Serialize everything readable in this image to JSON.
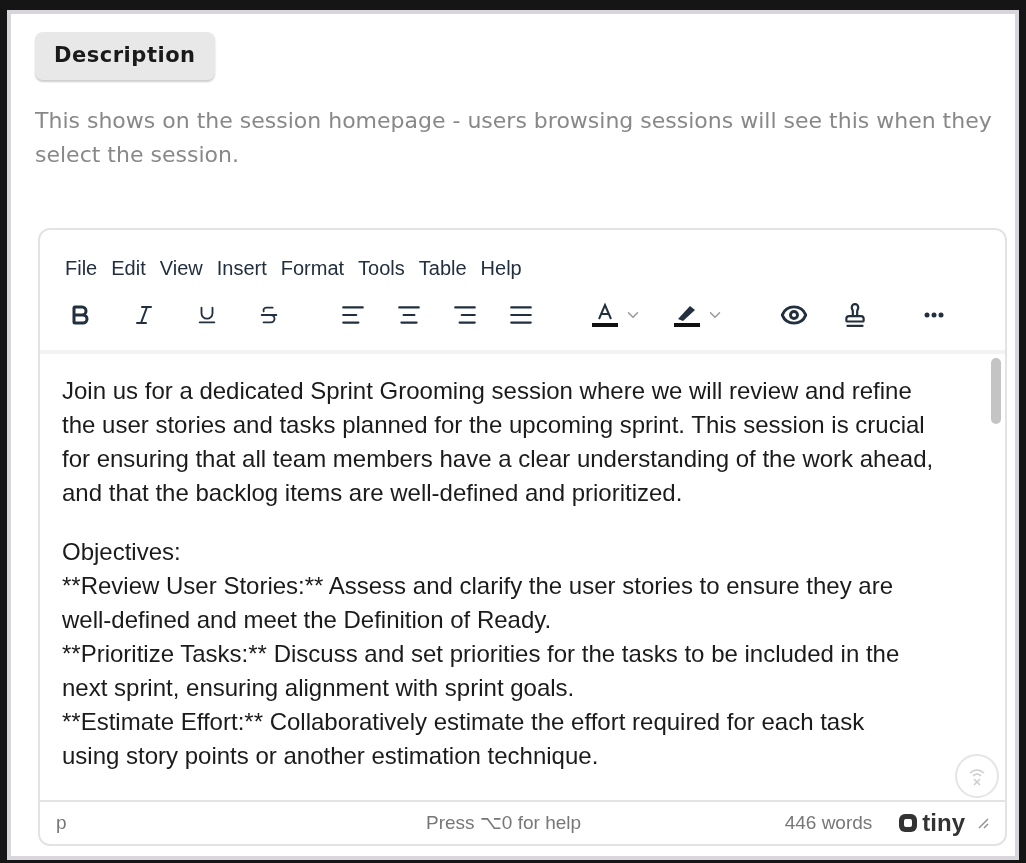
{
  "section_button": "Description",
  "help_text": "This shows on the session homepage - users browsing sessions will see this when they select the session.",
  "editor": {
    "menu": [
      "File",
      "Edit",
      "View",
      "Insert",
      "Format",
      "Tools",
      "Table",
      "Help"
    ],
    "content": [
      {
        "lines": [
          "Join us for a dedicated Sprint Grooming session where we will review and refine",
          "the user stories and tasks planned for the upcoming sprint. This session is crucial",
          "for ensuring that all team members have a clear understanding of the work ahead,",
          "and that the backlog items are well-defined and prioritized."
        ]
      },
      {
        "lines": [
          "Objectives:",
          "**Review User Stories:** Assess and clarify the user stories to ensure they are",
          "well-defined and meet the Definition of Ready.",
          "**Prioritize Tasks:** Discuss and set priorities for the tasks to be included in the",
          "next sprint, ensuring alignment with sprint goals.",
          "**Estimate Effort:** Collaboratively estimate the effort required for each task",
          "using story points or another estimation technique."
        ]
      }
    ],
    "status": {
      "path": "p",
      "help": "Press ⌥0 for help",
      "word_count": "446 words",
      "brand": "tiny"
    }
  }
}
